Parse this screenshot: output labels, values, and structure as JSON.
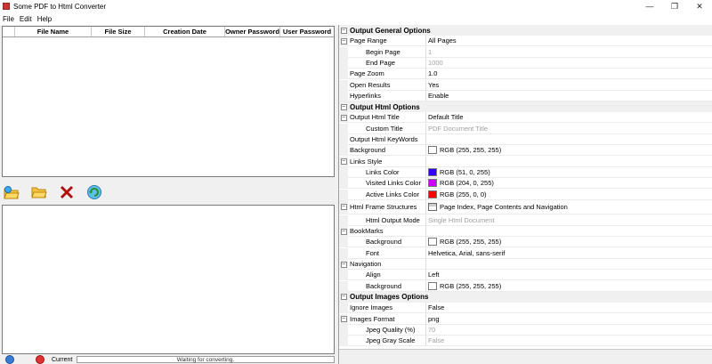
{
  "window": {
    "title": "Some PDF to Html Converter",
    "minimize": "—",
    "maximize": "❐",
    "close": "✕"
  },
  "menu": [
    {
      "label": "File"
    },
    {
      "label": "Edit"
    },
    {
      "label": "Help"
    }
  ],
  "file_list": {
    "columns": [
      "File Name",
      "File Size",
      "Creation Date",
      "Owner Password",
      "User Password"
    ]
  },
  "status": {
    "current_label": "Current",
    "progress_text": "Waiting for converting."
  },
  "properties": [
    {
      "kind": "category",
      "label": "Output General Options",
      "expander": "⊟"
    },
    {
      "kind": "prop",
      "name": "Page Range",
      "value": "All Pages",
      "indent": 0,
      "expander": "⊟"
    },
    {
      "kind": "prop",
      "name": "Begin Page",
      "value": "1",
      "indent": 1,
      "disabled": true
    },
    {
      "kind": "prop",
      "name": "End Page",
      "value": "1000",
      "indent": 1,
      "disabled": true
    },
    {
      "kind": "prop",
      "name": "Page Zoom",
      "value": "1.0",
      "indent": 0
    },
    {
      "kind": "prop",
      "name": "Open Results",
      "value": "Yes",
      "indent": 0
    },
    {
      "kind": "prop",
      "name": "Hyperlinks",
      "value": "Enable",
      "indent": 0
    },
    {
      "kind": "category",
      "label": "Output Html Options",
      "expander": "⊟"
    },
    {
      "kind": "prop",
      "name": "Output Html Title",
      "value": "Default Title",
      "indent": 0,
      "expander": "⊟"
    },
    {
      "kind": "prop",
      "name": "Custom Title",
      "value": "PDF Document Title",
      "indent": 1,
      "disabled": true
    },
    {
      "kind": "prop",
      "name": "Output Html KeyWords",
      "value": "",
      "indent": 0
    },
    {
      "kind": "prop",
      "name": "Background",
      "value": "RGB (255, 255, 255)",
      "indent": 0,
      "swatch": "#ffffff"
    },
    {
      "kind": "prop",
      "name": "Links Style",
      "value": "",
      "indent": 0,
      "expander": "⊟"
    },
    {
      "kind": "prop",
      "name": "Links Color",
      "value": "RGB (51, 0, 255)",
      "indent": 1,
      "swatch": "#3300ff"
    },
    {
      "kind": "prop",
      "name": "Visited Links Color",
      "value": "RGB (204, 0, 255)",
      "indent": 1,
      "swatch": "#cc00ff"
    },
    {
      "kind": "prop",
      "name": "Active Links Color",
      "value": "RGB (255, 0, 0)",
      "indent": 1,
      "swatch": "#ff0000"
    },
    {
      "kind": "prop",
      "name": "Html Frame Structures",
      "value": "Page Index, Page Contents and Navigation",
      "indent": 0,
      "expander": "⊟",
      "tall": true,
      "frame_icon": true
    },
    {
      "kind": "prop",
      "name": "Html Output Mode",
      "value": "Single Html Document",
      "indent": 1,
      "disabled": true
    },
    {
      "kind": "prop",
      "name": "BookMarks",
      "value": "",
      "indent": 0,
      "expander": "⊟"
    },
    {
      "kind": "prop",
      "name": "Background",
      "value": "RGB (255, 255, 255)",
      "indent": 1,
      "swatch": "#ffffff"
    },
    {
      "kind": "prop",
      "name": "Font",
      "value": "Helvetica, Arial, sans-serif",
      "indent": 1
    },
    {
      "kind": "prop",
      "name": "Navigation",
      "value": "",
      "indent": 0,
      "expander": "⊟"
    },
    {
      "kind": "prop",
      "name": "Align",
      "value": "Left",
      "indent": 1
    },
    {
      "kind": "prop",
      "name": "Background",
      "value": "RGB (255, 255, 255)",
      "indent": 1,
      "swatch": "#ffffff"
    },
    {
      "kind": "category",
      "label": "Output Images Options",
      "expander": "⊟"
    },
    {
      "kind": "prop",
      "name": "Ignore Images",
      "value": "False",
      "indent": 0
    },
    {
      "kind": "prop",
      "name": "Images Format",
      "value": "png",
      "indent": 0,
      "expander": "⊟"
    },
    {
      "kind": "prop",
      "name": "Jpeg Quality (%)",
      "value": "70",
      "indent": 1,
      "disabled": true
    },
    {
      "kind": "prop",
      "name": "Jpeg Gray Scale",
      "value": "False",
      "indent": 1,
      "disabled": true
    }
  ]
}
